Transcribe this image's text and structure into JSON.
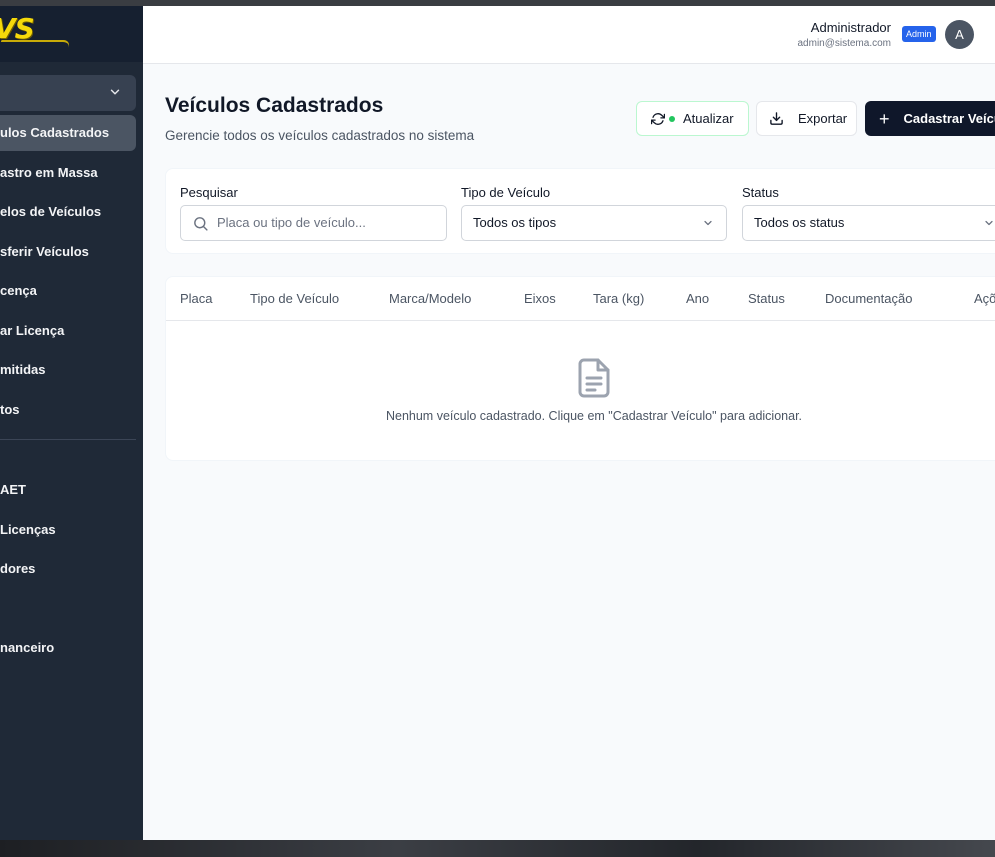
{
  "sidebar": {
    "logo_text": "VS",
    "items": [
      {
        "label": "ulos Cadastrados",
        "active": true
      },
      {
        "label": "astro em Massa"
      },
      {
        "label": "elos de Veículos"
      },
      {
        "label": "sferir Veículos"
      },
      {
        "label": "cença"
      },
      {
        "label": "ar Licença"
      },
      {
        "label": "mitidas"
      },
      {
        "label": "tos"
      },
      {
        "label": " AET"
      },
      {
        "label": "Licenças"
      },
      {
        "label": "dores"
      },
      {
        "label": "nanceiro"
      }
    ]
  },
  "header": {
    "user_name": "Administrador",
    "user_email": "admin@sistema.com",
    "badge": "Admin",
    "avatar_initial": "A"
  },
  "page": {
    "title": "Veículos Cadastrados",
    "subtitle": "Gerencie todos os veículos cadastrados no sistema"
  },
  "actions": {
    "refresh_label": "Atualizar",
    "export_label": "Exportar",
    "create_label": "Cadastrar Veícu"
  },
  "filters": {
    "search_label": "Pesquisar",
    "search_placeholder": "Placa ou tipo de veículo...",
    "type_label": "Tipo de Veículo",
    "type_value": "Todos os tipos",
    "status_label": "Status",
    "status_value": "Todos os status"
  },
  "table": {
    "columns": [
      "Placa",
      "Tipo de Veículo",
      "Marca/Modelo",
      "Eixos",
      "Tara (kg)",
      "Ano",
      "Status",
      "Documentação",
      "Açõ"
    ],
    "empty_message": "Nenhum veículo cadastrado. Clique em \"Cadastrar Veículo\" para adicionar."
  },
  "colors": {
    "sidebar_bg": "#1f2937",
    "primary_button": "#0f172a",
    "badge": "#2563eb",
    "status_dot": "#22c55e",
    "logo": "#f5d90a"
  }
}
